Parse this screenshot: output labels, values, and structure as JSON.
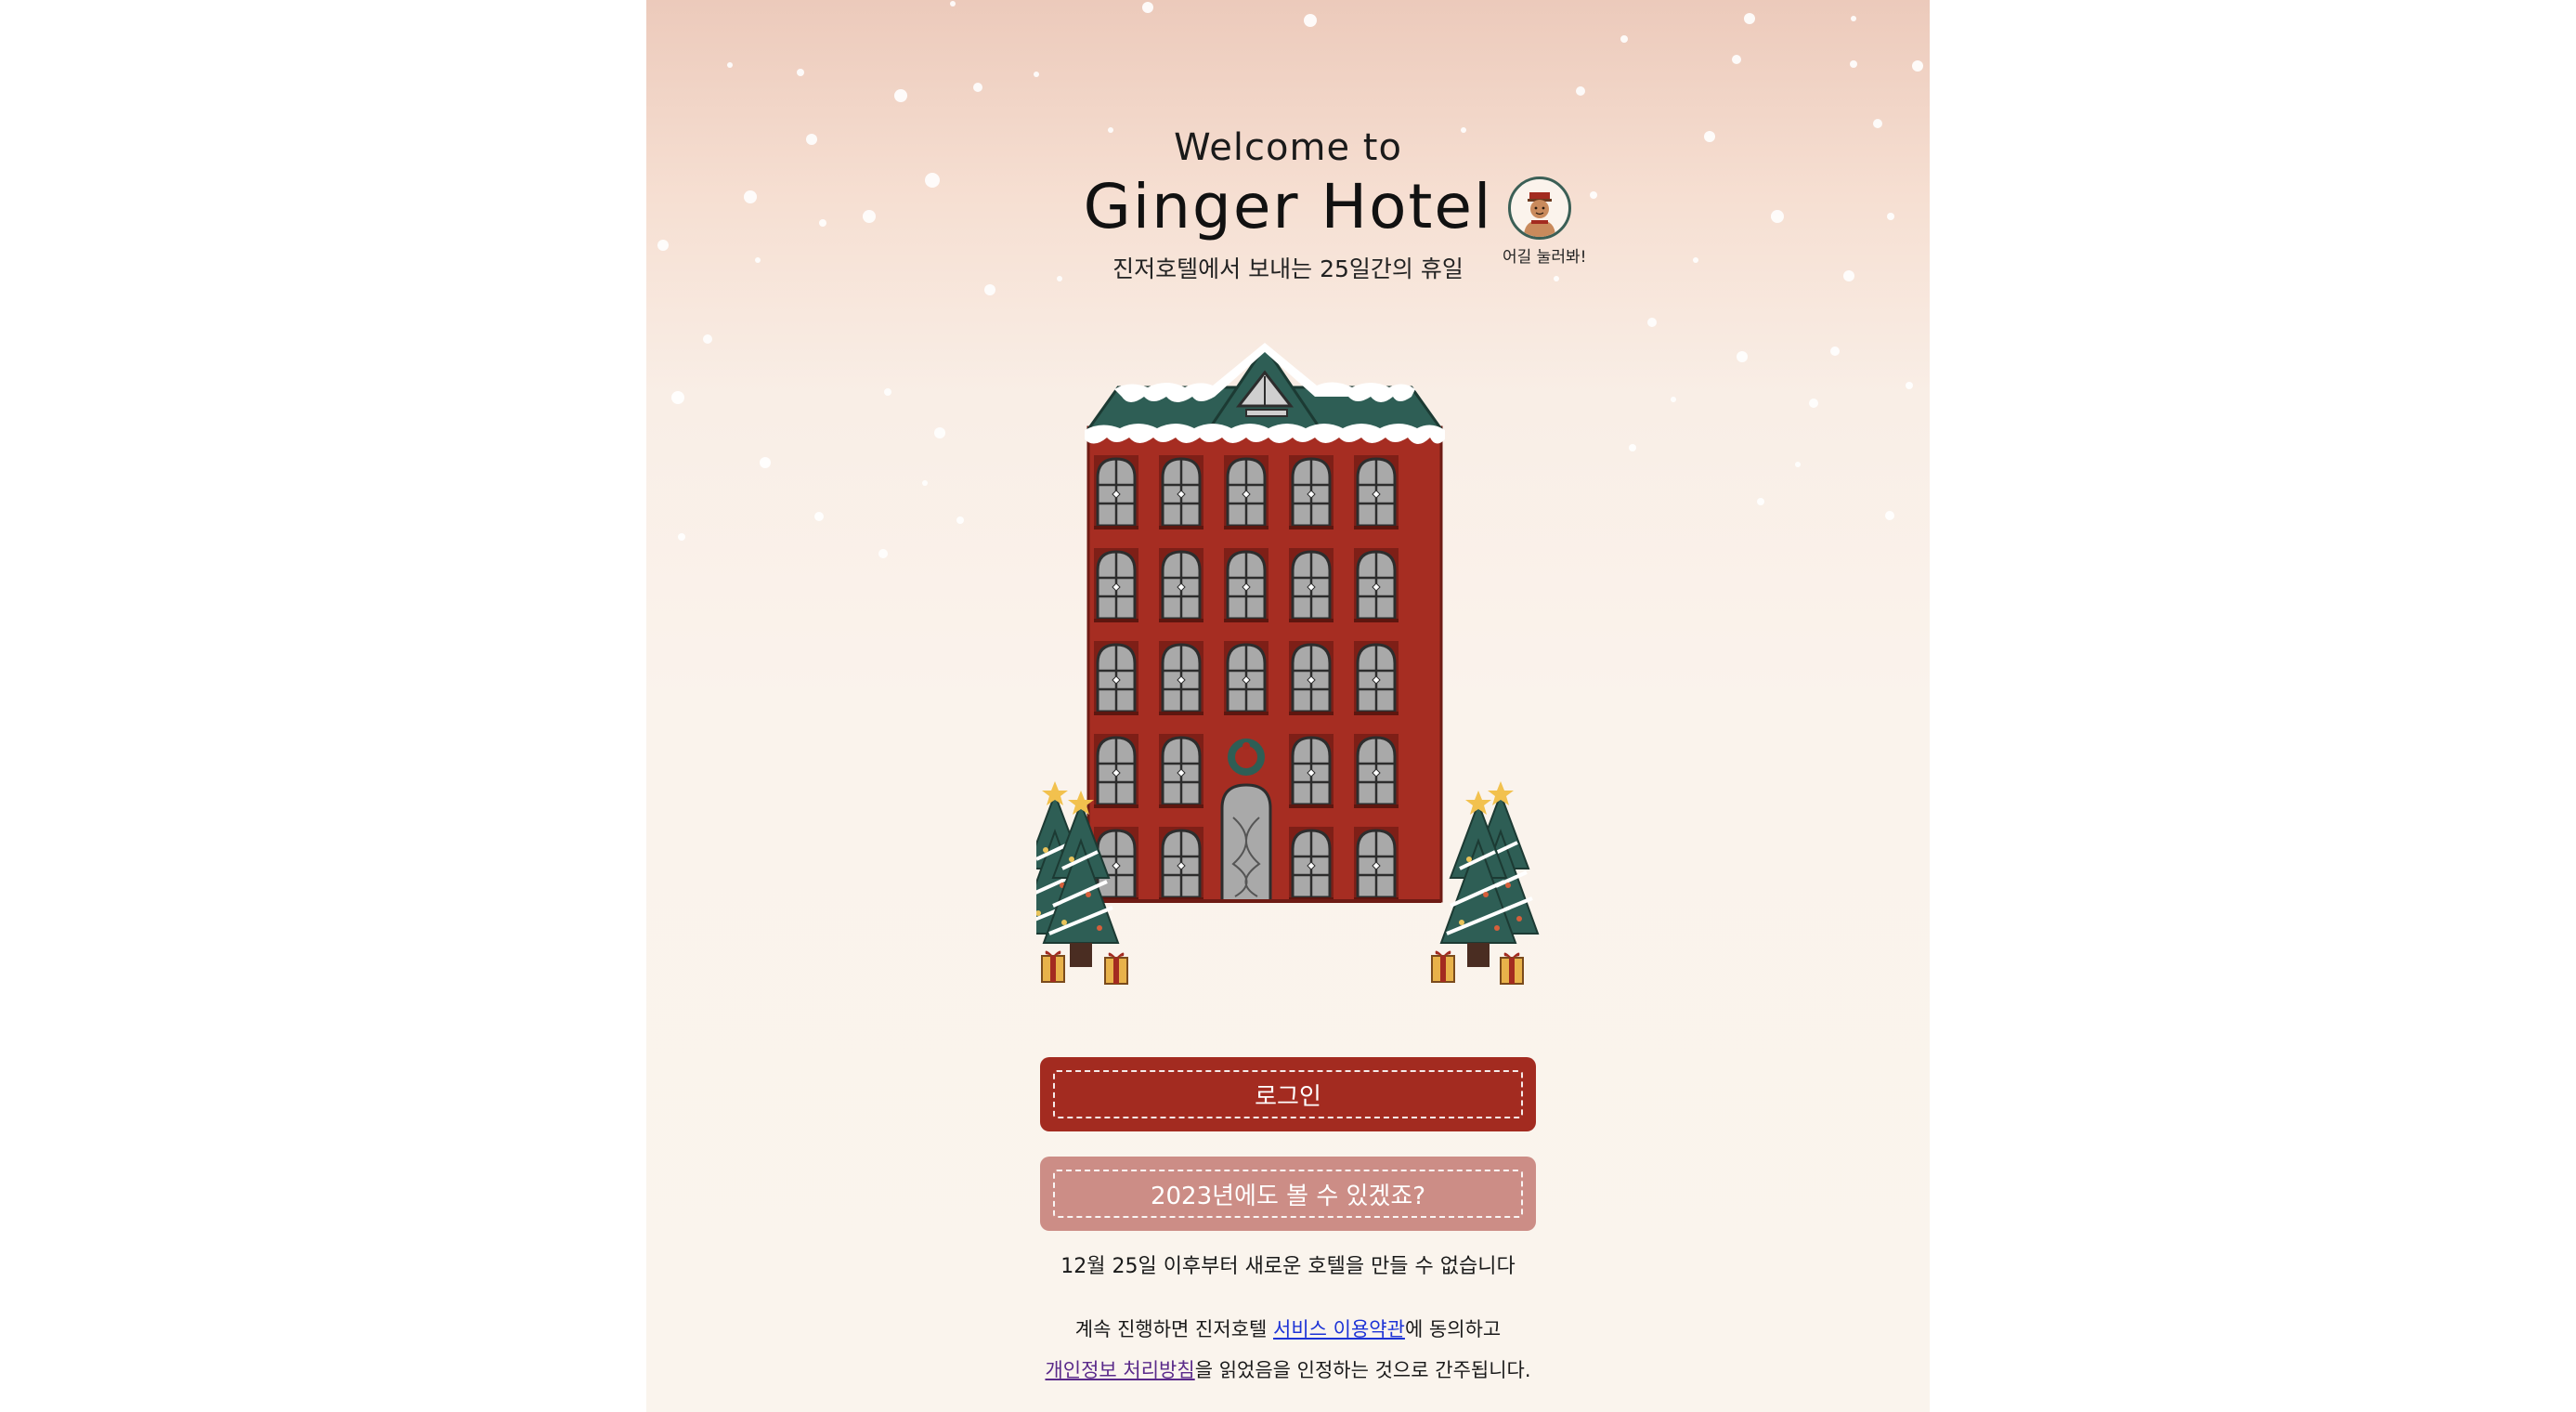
{
  "header": {
    "welcome": "Welcome to",
    "title": "Ginger Hotel",
    "subtitle": "진저호텔에서 보내는 25일간의 휴일"
  },
  "profile": {
    "icon": "gingerbread-avatar-icon",
    "label": "어길 눌러봐!"
  },
  "buttons": {
    "login": "로그인",
    "see_2023": "2023년에도 볼 수 있겠죠?"
  },
  "notice": "12월 25일 이후부터 새로운 호텔을 만들 수 없습니다",
  "terms": {
    "line1_prefix": "계속 진행하면 진저호텔 ",
    "service_link": "서비스 이용약관",
    "line1_suffix": "에 동의하고",
    "privacy_link": "개인정보 처리방침",
    "line2_suffix": "을 읽었음을 인정하는 것으로 간주됩니다."
  },
  "colors": {
    "primary_button": "#a32b20",
    "secondary_button": "#cc8d86",
    "hotel_brick": "#a62d22",
    "roof": "#2e5e55",
    "link": "#1d33d6"
  }
}
